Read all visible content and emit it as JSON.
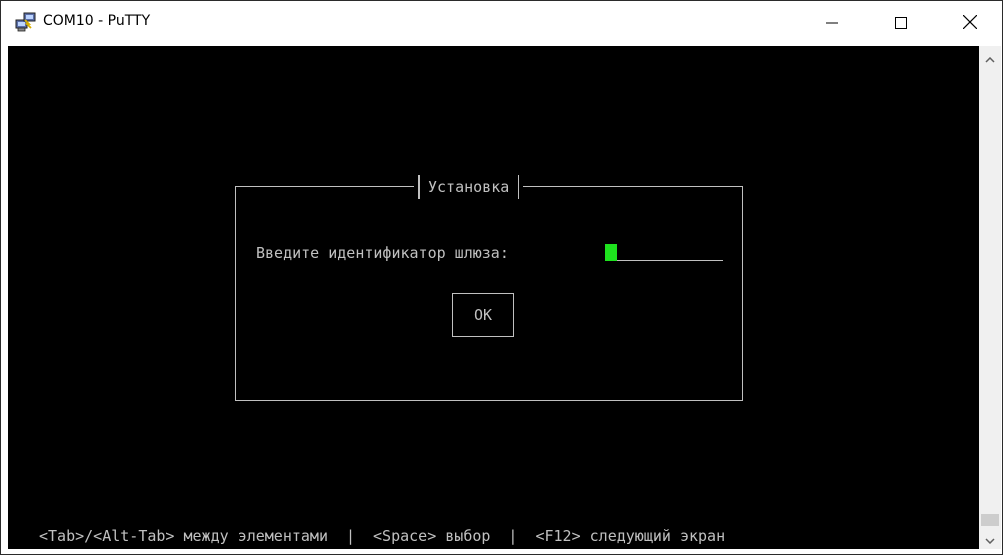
{
  "window": {
    "title": "COM10 - PuTTY",
    "app_icon": "putty-computers-icon"
  },
  "titlebar_buttons": {
    "minimize_icon": "minimize-icon",
    "maximize_icon": "maximize-icon",
    "close_icon": "close-icon"
  },
  "dialog": {
    "title": "Установка",
    "prompt": "Введите идентификатор шлюза:",
    "input_value": "",
    "ok_label": "OK"
  },
  "status_bar": {
    "hint1": "<Tab>/<Alt-Tab> между элементами",
    "sep1": "|",
    "hint2": "<Space> выбор",
    "sep2": "|",
    "hint3": "<F12> следующий экран"
  },
  "colors": {
    "terminal_bg": "#000000",
    "terminal_fg": "#c0c0c0",
    "cursor": "#1ee21e"
  }
}
